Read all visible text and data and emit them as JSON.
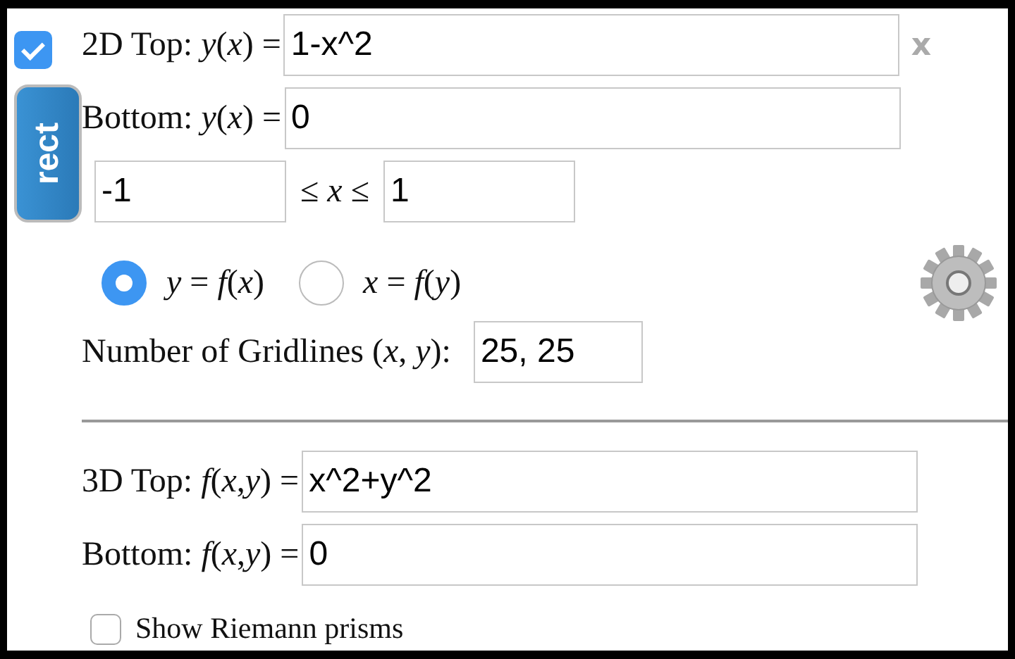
{
  "enabled": {
    "checked": true
  },
  "mode_button": "rect",
  "top_2d": {
    "label": "2D Top: *y*(*x*) =",
    "value": "1-x^2"
  },
  "remove": "x",
  "bottom_2d": {
    "label": "Bottom: *y*(*x*) =",
    "value": "0"
  },
  "range": {
    "min": "-1",
    "relation": "≤ *x* ≤",
    "max": "1"
  },
  "orientation": [
    {
      "label": "*y* = *f*(*x*)",
      "selected": true
    },
    {
      "label": "*x* = *f*(*y*)",
      "selected": false
    }
  ],
  "gridlines": {
    "label": "Number of Gridlines (*x*, *y*):",
    "value": "25, 25"
  },
  "top_3d": {
    "label": "3D Top: *f*(*x*,*y*) =",
    "value": "x^2+y^2"
  },
  "bottom_3d": {
    "label": "Bottom: *f*(*x*,*y*) =",
    "value": "0"
  },
  "riemann": {
    "label": "Show Riemann prisms",
    "checked": false
  }
}
